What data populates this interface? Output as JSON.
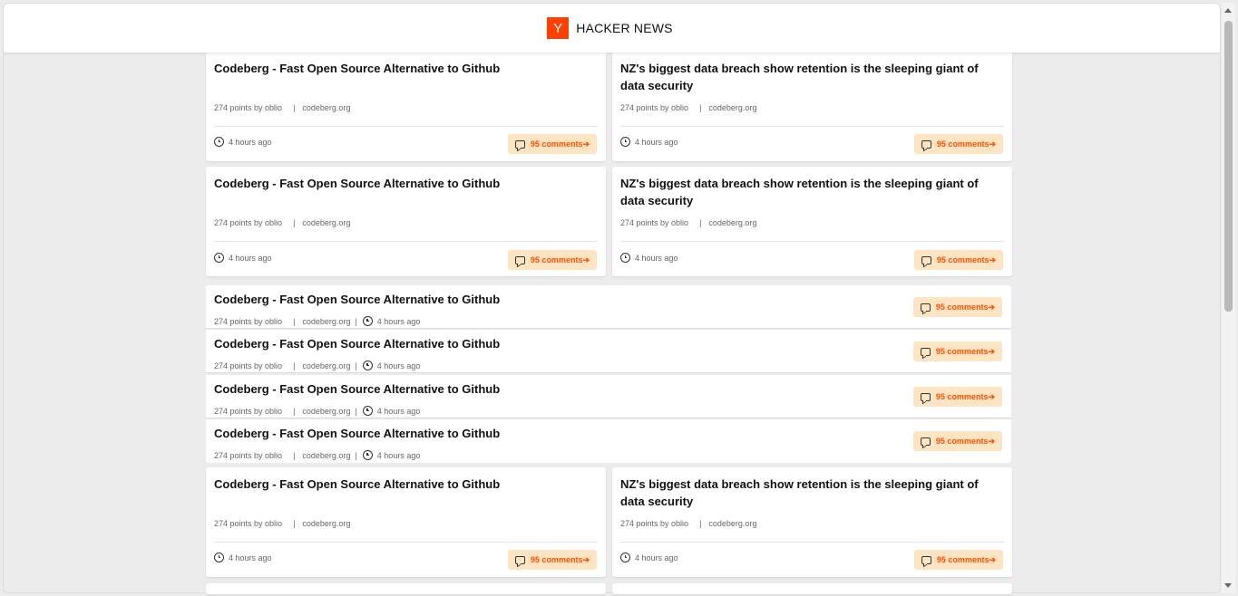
{
  "header": {
    "logo": "Y",
    "brand": "HACKER NEWS"
  },
  "stories": [
    {
      "title": "Codeberg - Fast Open Source Alternative to Github",
      "points": "274 points by oblio",
      "site": "codeberg.org",
      "time": "4 hours ago",
      "comments": "95 comments➔"
    },
    {
      "title": "NZ's biggest data breach show retention is the sleeping giant of data security",
      "points": "274 points by oblio",
      "site": "codeberg.org",
      "time": "4 hours ago",
      "comments": "95 comments➔"
    }
  ],
  "separator": "|",
  "icons": {
    "clock": "clock-icon",
    "comments": "comment-bubble-icon"
  },
  "colors": {
    "accent": "#ff4000",
    "comment_bg": "#fde4c2",
    "comment_text": "#ff4d00"
  }
}
